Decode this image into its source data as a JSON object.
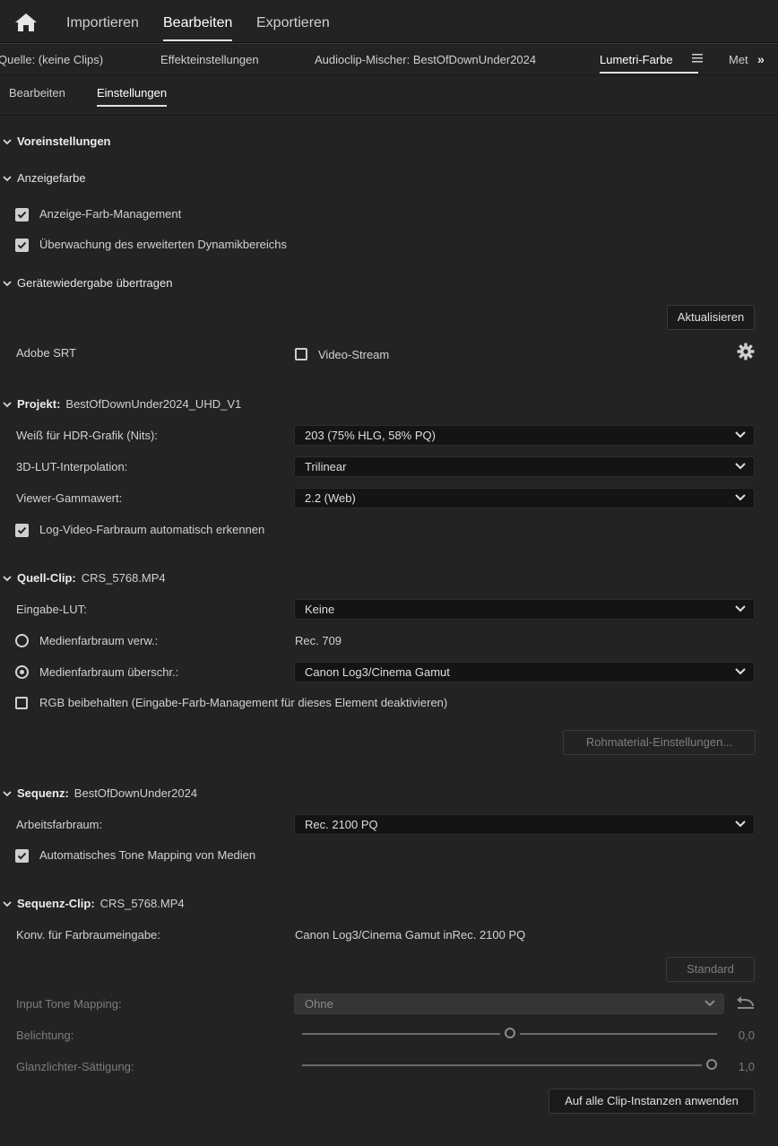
{
  "topbar": {
    "tabs": [
      {
        "label": "Importieren"
      },
      {
        "label": "Bearbeiten"
      },
      {
        "label": "Exportieren"
      }
    ]
  },
  "panel_tabs": {
    "items": [
      {
        "label": "Quelle: (keine Clips)"
      },
      {
        "label": "Effekteinstellungen"
      },
      {
        "label": "Audioclip-Mischer: BestOfDownUnder2024"
      },
      {
        "label": "Lumetri-Farbe"
      },
      {
        "label": "Met"
      }
    ]
  },
  "subtabs": {
    "items": [
      {
        "label": "Bearbeiten"
      },
      {
        "label": "Einstellungen"
      }
    ]
  },
  "presets": {
    "title": "Voreinstellungen"
  },
  "display_color": {
    "title": "Anzeigefarbe",
    "mgmt_label": "Anzeige-Farb-Management",
    "hdr_label": "Überwachung des erweiterten Dynamikbereichs"
  },
  "device_playback": {
    "title": "Gerätewiedergabe übertragen",
    "refresh_label": "Aktualisieren",
    "srt_label": "Adobe SRT",
    "stream_label": "Video-Stream"
  },
  "project": {
    "title": "Projekt:",
    "name": "BestOfDownUnder2024_UHD_V1",
    "white_label": "Weiß für HDR-Grafik (Nits):",
    "white_value": "203 (75% HLG, 58% PQ)",
    "lut_label": "3D-LUT-Interpolation:",
    "lut_value": "Trilinear",
    "gamma_label": "Viewer-Gammawert:",
    "gamma_value": "2.2 (Web)",
    "log_label": "Log-Video-Farbraum automatisch erkennen"
  },
  "source_clip": {
    "title": "Quell-Clip:",
    "name": "CRS_5768.MP4",
    "input_lut_label": "Eingabe-LUT:",
    "input_lut_value": "Keine",
    "use_media_label": "Medienfarbraum verw.:",
    "use_media_value": "Rec. 709",
    "override_label": "Medienfarbraum überschr.:",
    "override_value": "Canon Log3/Cinema Gamut",
    "rgb_label": "RGB beibehalten (Eingabe-Farb-Management für dieses Element deaktivieren)",
    "raw_label": "Rohmaterial-Einstellungen..."
  },
  "sequence": {
    "title": "Sequenz:",
    "name": "BestOfDownUnder2024",
    "working_label": "Arbeitsfarbraum:",
    "working_value": "Rec. 2100 PQ",
    "tone_label": "Automatisches Tone Mapping von Medien"
  },
  "sequence_clip": {
    "title": "Sequenz-Clip:",
    "name": "CRS_5768.MP4",
    "conv_label": "Konv. für Farbraumeingabe:",
    "conv_value": "Canon Log3/Cinema Gamut inRec. 2100 PQ",
    "standard_label": "Standard",
    "itm_label": "Input Tone Mapping:",
    "itm_value": "Ohne",
    "exposure_label": "Belichtung:",
    "exposure_value": "0,0",
    "exposure_level": 0.5,
    "highlight_label": "Glanzlichter-Sättigung:",
    "highlight_value": "1,0",
    "highlight_level": 1.0,
    "apply_label": "Auf alle Clip-Instanzen anwenden"
  },
  "colors": {
    "bg": "#232323",
    "accent": "#e0e0e0"
  }
}
